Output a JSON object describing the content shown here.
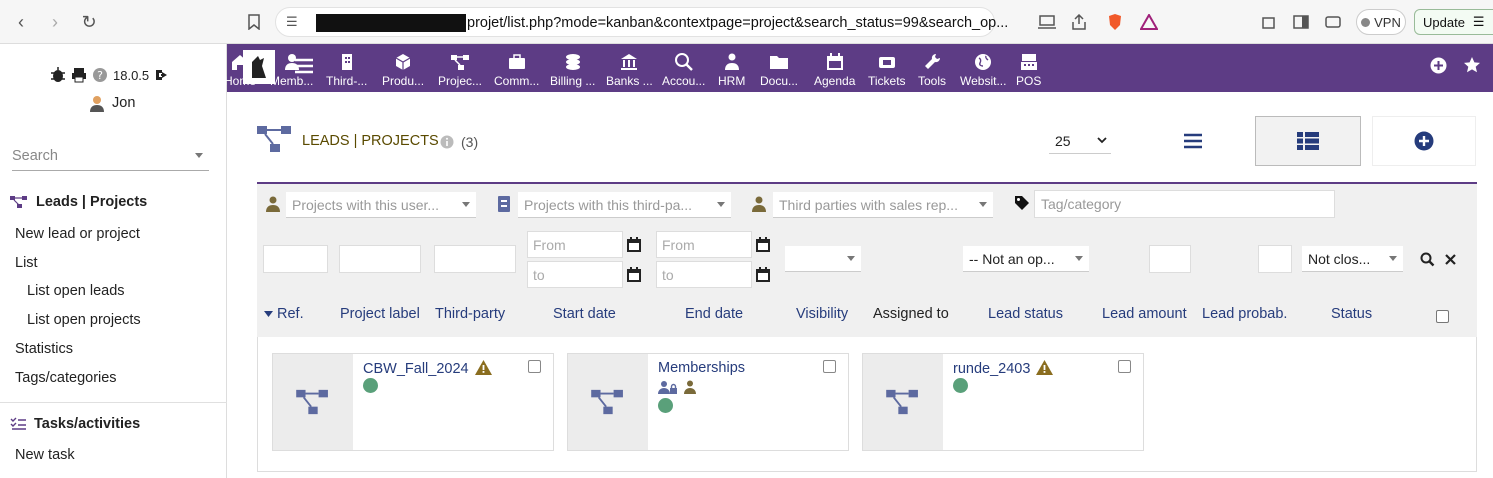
{
  "browser": {
    "url_visible": "projet/list.php?mode=kanban&contextpage=project&search_status=99&search_op...",
    "vpn_label": "VPN",
    "update_label": "Update"
  },
  "sidebar": {
    "version": "18.0.5",
    "user": "Jon",
    "search_placeholder": "Search",
    "section1_title": "Leads | Projects",
    "items": [
      "New lead or project",
      "List",
      "List open leads",
      "List open projects",
      "Statistics",
      "Tags/categories"
    ],
    "section2_title": "Tasks/activities",
    "items2": [
      "New task"
    ]
  },
  "nav": {
    "items": [
      "Home",
      "Memb...",
      "Third-...",
      "Produ...",
      "Projec...",
      "Comm...",
      "Billing ...",
      "Banks ...",
      "Accou...",
      "HRM",
      "Docu...",
      "Agenda",
      "Tickets",
      "Tools",
      "Websit...",
      "POS"
    ]
  },
  "page": {
    "title": "LEADS | PROJECTS",
    "count": "(3)",
    "limit": "25"
  },
  "filters": {
    "user_placeholder": "Projects with this user...",
    "thirdparty_placeholder": "Projects with this third-pa...",
    "salesrep_placeholder": "Third parties with sales rep...",
    "tag_placeholder": "Tag/category",
    "from": "From",
    "to": "to",
    "opp_status": "-- Not an op...",
    "status": "Not clos..."
  },
  "columns": [
    "Ref.",
    "Project label",
    "Third-party",
    "Start date",
    "End date",
    "Visibility",
    "Assigned to",
    "Lead status",
    "Lead amount",
    "Lead probab.",
    "Status"
  ],
  "cards": [
    {
      "title": "CBW_Fall_2024"
    },
    {
      "title": "Memberships"
    },
    {
      "title": "runde_2403"
    }
  ],
  "colors": {
    "accent": "#5d3c85",
    "link": "#263c7c",
    "status_green": "#5aa07a",
    "warning": "#8a6d1f"
  }
}
